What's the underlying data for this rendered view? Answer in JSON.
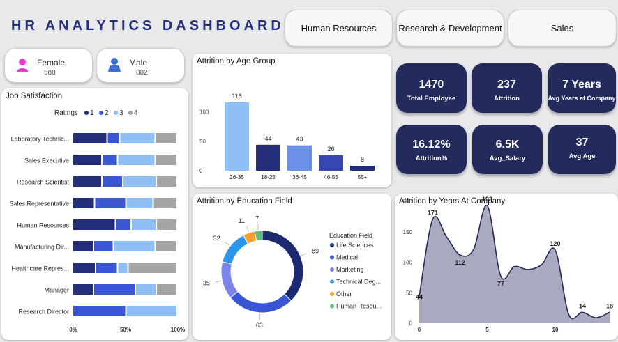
{
  "header": {
    "title": "HR ANALYTICS DASHBOARD"
  },
  "dept_buttons": [
    "Human Resources",
    "Research & Development",
    "Sales"
  ],
  "gender": {
    "female_label": "Female",
    "female_count": "588",
    "male_label": "Male",
    "male_count": "882"
  },
  "kpis": [
    {
      "value": "1470",
      "label": "Total Employee"
    },
    {
      "value": "237",
      "label": "Attrition"
    },
    {
      "value": "7 Years",
      "label": "Avg Years at Company"
    },
    {
      "value": "16.12%",
      "label": "Attrition%"
    },
    {
      "value": "6.5K",
      "label": "Avg_Salary"
    },
    {
      "value": "37",
      "label": "Avg Age"
    }
  ],
  "colors": {
    "navy": "#232a5c",
    "dark_blue": "#232d7a",
    "blue": "#3a56d4",
    "light_blue": "#8fc0f5",
    "grey": "#a7a4a8"
  },
  "chart_data": [
    {
      "type": "bar",
      "title": "Job Satisfaction",
      "legend_title": "Ratings",
      "legend": [
        "1",
        "2",
        "3",
        "4"
      ],
      "categories": [
        "Laboratory Technic...",
        "Sales Executive",
        "Research Scientist",
        "Sales Representative",
        "Human Resources",
        "Manufacturing Dir...",
        "Healthcare Repres...",
        "Manager",
        "Research Director"
      ],
      "series": [
        {
          "name": "1",
          "values": [
            33,
            28,
            28,
            21,
            41,
            20,
            22,
            20,
            0
          ]
        },
        {
          "name": "2",
          "values": [
            12,
            15,
            20,
            30,
            15,
            19,
            21,
            40,
            51
          ]
        },
        {
          "name": "3",
          "values": [
            34,
            36,
            32,
            26,
            24,
            40,
            10,
            20,
            49
          ]
        },
        {
          "name": "4",
          "values": [
            21,
            21,
            20,
            23,
            20,
            21,
            47,
            20,
            0
          ]
        }
      ],
      "stacked": "100%",
      "xticks": [
        "0%",
        "50%",
        "100%"
      ]
    },
    {
      "type": "bar",
      "title": "Attrition by Age Group",
      "categories": [
        "26-35",
        "18-25",
        "36-45",
        "46-55",
        "55+"
      ],
      "values": [
        116,
        44,
        43,
        26,
        8
      ],
      "yticks": [
        "0",
        "50",
        "100"
      ],
      "ylim": [
        0,
        125
      ]
    },
    {
      "type": "pie",
      "title": "Attrition by Education Field",
      "legend_title": "Education Field",
      "categories": [
        "Life Sciences",
        "Medical",
        "Marketing",
        "Technical Deg...",
        "Other",
        "Human Resou..."
      ],
      "values": [
        89,
        63,
        35,
        32,
        11,
        7
      ]
    },
    {
      "type": "area",
      "title": "Attrition by Years At Company",
      "x": [
        0,
        1,
        2,
        3,
        4,
        5,
        6,
        7,
        8,
        9,
        10,
        11,
        12,
        13,
        14
      ],
      "y": [
        44,
        171,
        142,
        112,
        121,
        193,
        77,
        93,
        88,
        96,
        120,
        14,
        18,
        9,
        18
      ],
      "point_labels": [
        {
          "x": 0,
          "label": "44"
        },
        {
          "x": 1,
          "label": "171"
        },
        {
          "x": 3,
          "label": "112"
        },
        {
          "x": 5,
          "label": "193"
        },
        {
          "x": 6,
          "label": "77"
        },
        {
          "x": 10,
          "label": "120"
        },
        {
          "x": 12,
          "label": "14"
        },
        {
          "x": 14,
          "label": "18"
        }
      ],
      "xticks": [
        "0",
        "5",
        "10"
      ],
      "yticks": [
        "0",
        "50",
        "100",
        "150",
        "200"
      ],
      "ylim": [
        0,
        200
      ],
      "xlim": [
        0,
        14
      ]
    }
  ]
}
